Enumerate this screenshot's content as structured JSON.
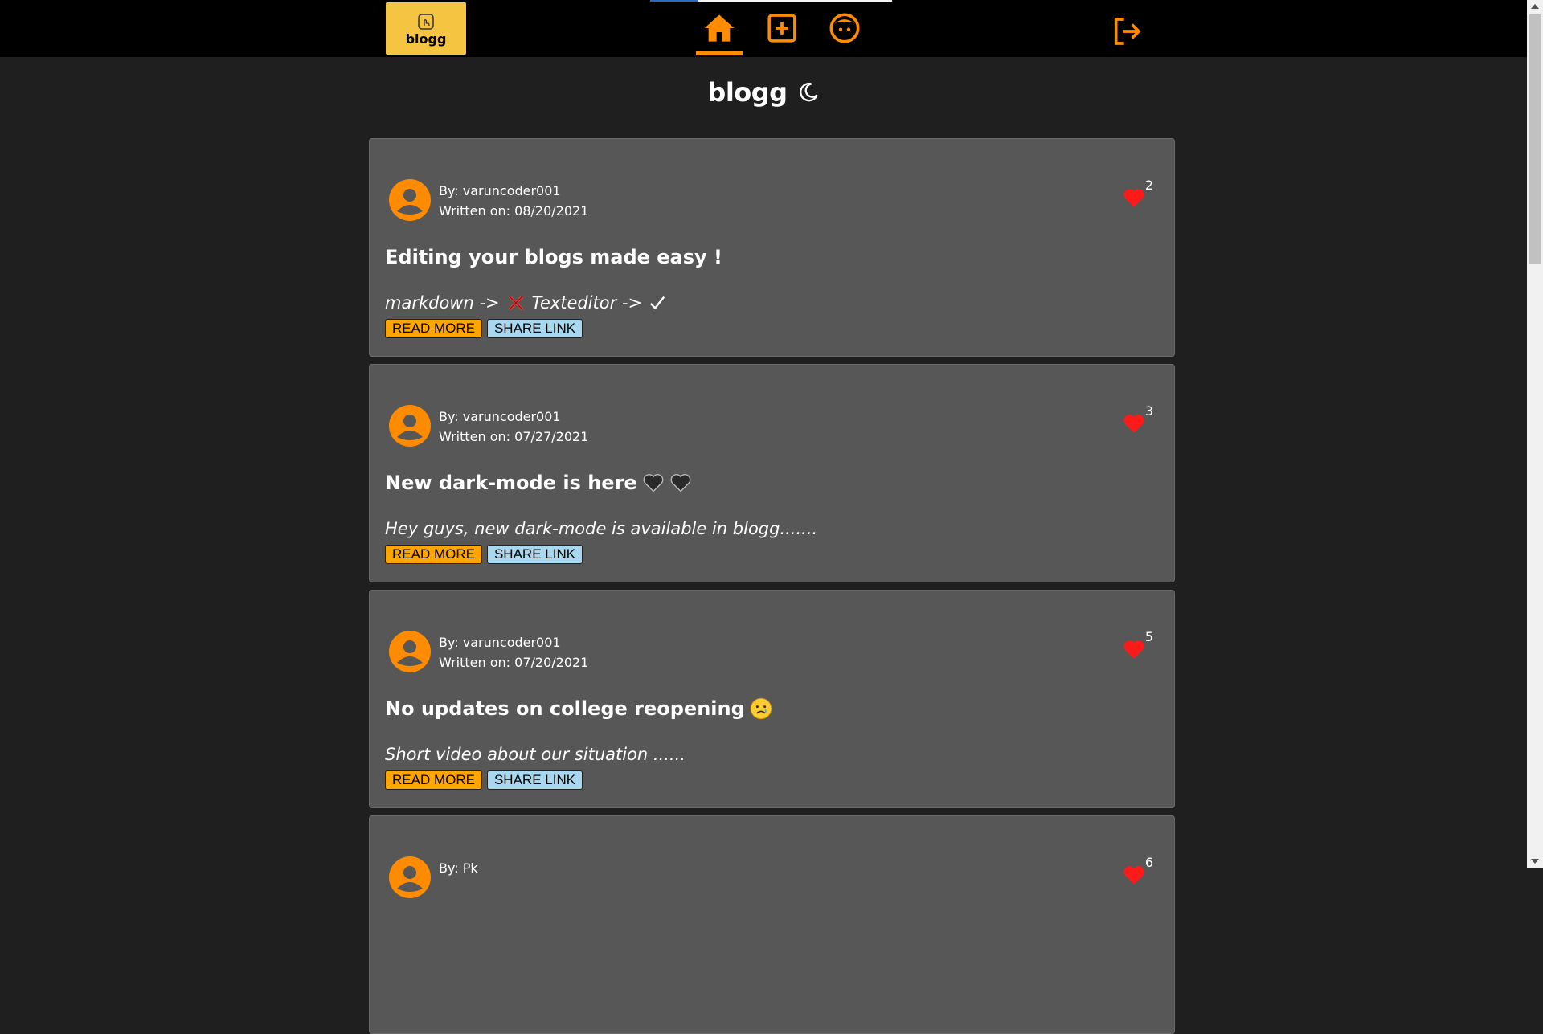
{
  "header": {
    "logo_text": "blogg",
    "nav": [
      {
        "name": "home",
        "active": true
      },
      {
        "name": "create-post",
        "active": false
      },
      {
        "name": "profile",
        "active": false
      }
    ]
  },
  "brand": {
    "title": "blogg",
    "theme_icon": "moon-icon"
  },
  "buttons": {
    "read_more": "READ MORE",
    "share_link": "SHARE LINK"
  },
  "posts": [
    {
      "author": "By: varuncoder001",
      "date": "Written on: 08/20/2021",
      "likes": "2",
      "title": "Editing your blogs made easy !",
      "excerpt_part1": "markdown ->",
      "excerpt_part2": "Texteditor ->"
    },
    {
      "author": "By: varuncoder001",
      "date": "Written on: 07/27/2021",
      "likes": "3",
      "title": "New dark-mode is here",
      "excerpt": "Hey guys, new dark-mode is available in blogg......."
    },
    {
      "author": "By: varuncoder001",
      "date": "Written on: 07/20/2021",
      "likes": "5",
      "title": "No updates on college reopening",
      "excerpt": "Short video about our situation ......"
    },
    {
      "author": "By: Pk",
      "likes": "6"
    }
  ],
  "colors": {
    "accent": "#ff8c00",
    "logo_bg": "#f5c542",
    "card_bg": "#575757",
    "page_bg": "#1f1f1f",
    "heart": "#ff1a1a"
  }
}
